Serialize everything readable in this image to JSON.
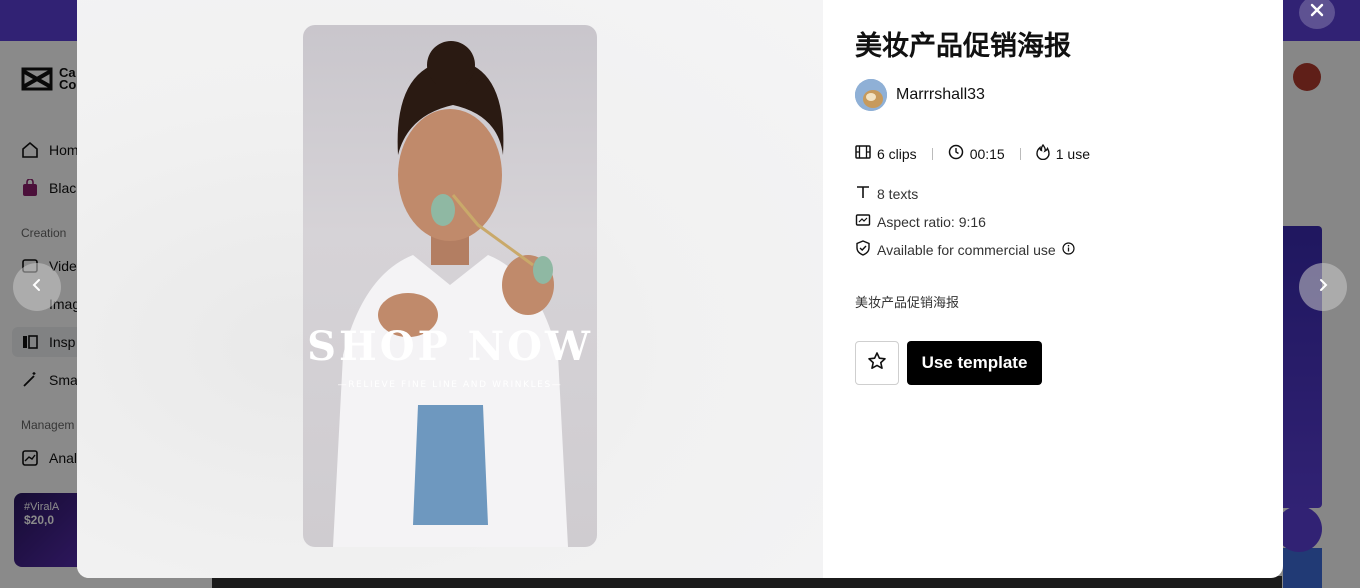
{
  "background": {
    "logo_text": "Ca\nCo",
    "sidebar_items": [
      {
        "label": "Hom",
        "icon": "home-icon"
      },
      {
        "label": "Blac",
        "icon": "shopping-bag-icon"
      },
      {
        "label": "Vide",
        "icon": "video-icon"
      },
      {
        "label": "Imag",
        "icon": "image-icon"
      },
      {
        "label": "Insp",
        "icon": "inspiration-icon"
      },
      {
        "label": "Sma",
        "icon": "magic-wand-icon"
      },
      {
        "label": "Anal",
        "icon": "analytics-icon"
      }
    ],
    "section_creation": "Creation",
    "section_management": "Managem",
    "promo_line1": "#ViralA",
    "promo_line2": "$20,0"
  },
  "modal": {
    "title": "美妆产品促销海报",
    "author": "Marrrshall33",
    "stats": {
      "clips": "6 clips",
      "duration": "00:15",
      "uses": "1 use"
    },
    "texts": "8 texts",
    "aspect_ratio": "Aspect ratio: 9:16",
    "commercial": "Available for commercial use",
    "description": "美妆产品促销海报",
    "use_template_label": "Use template",
    "preview": {
      "headline": "SHOP NOW",
      "subline": "—RELIEVE FINE LINE AND WRINKLES—"
    }
  },
  "colors": {
    "brand_purple": "#5b3fd6",
    "button_black": "#000000"
  }
}
